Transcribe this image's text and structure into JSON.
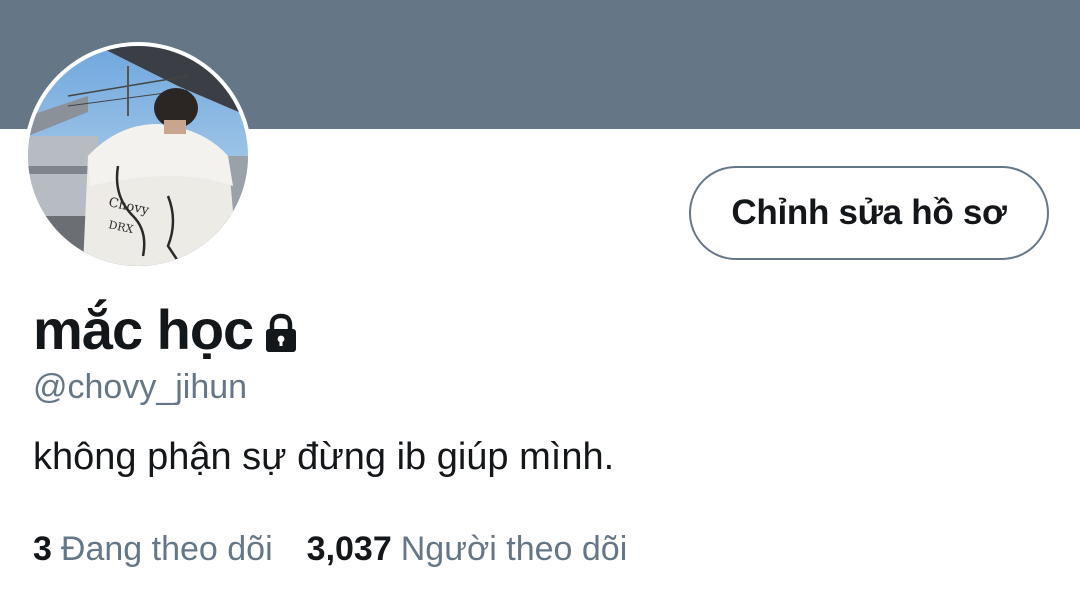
{
  "header": {
    "banner_color": "#657786"
  },
  "profile": {
    "avatar_description": "avatar-photo",
    "display_name": "mắc học",
    "handle": "@chovy_jihun",
    "bio": "không phận sự đừng ib giúp mình.",
    "protected_icon": "lock-icon"
  },
  "actions": {
    "edit_profile_label": "Chỉnh sửa hồ sơ"
  },
  "stats": {
    "following_count": "3",
    "following_label": "Đang theo dõi",
    "followers_count": "3,037",
    "followers_label": "Người theo dõi"
  },
  "colors": {
    "text_primary": "#14171a",
    "text_secondary": "#657786",
    "background": "#ffffff"
  }
}
